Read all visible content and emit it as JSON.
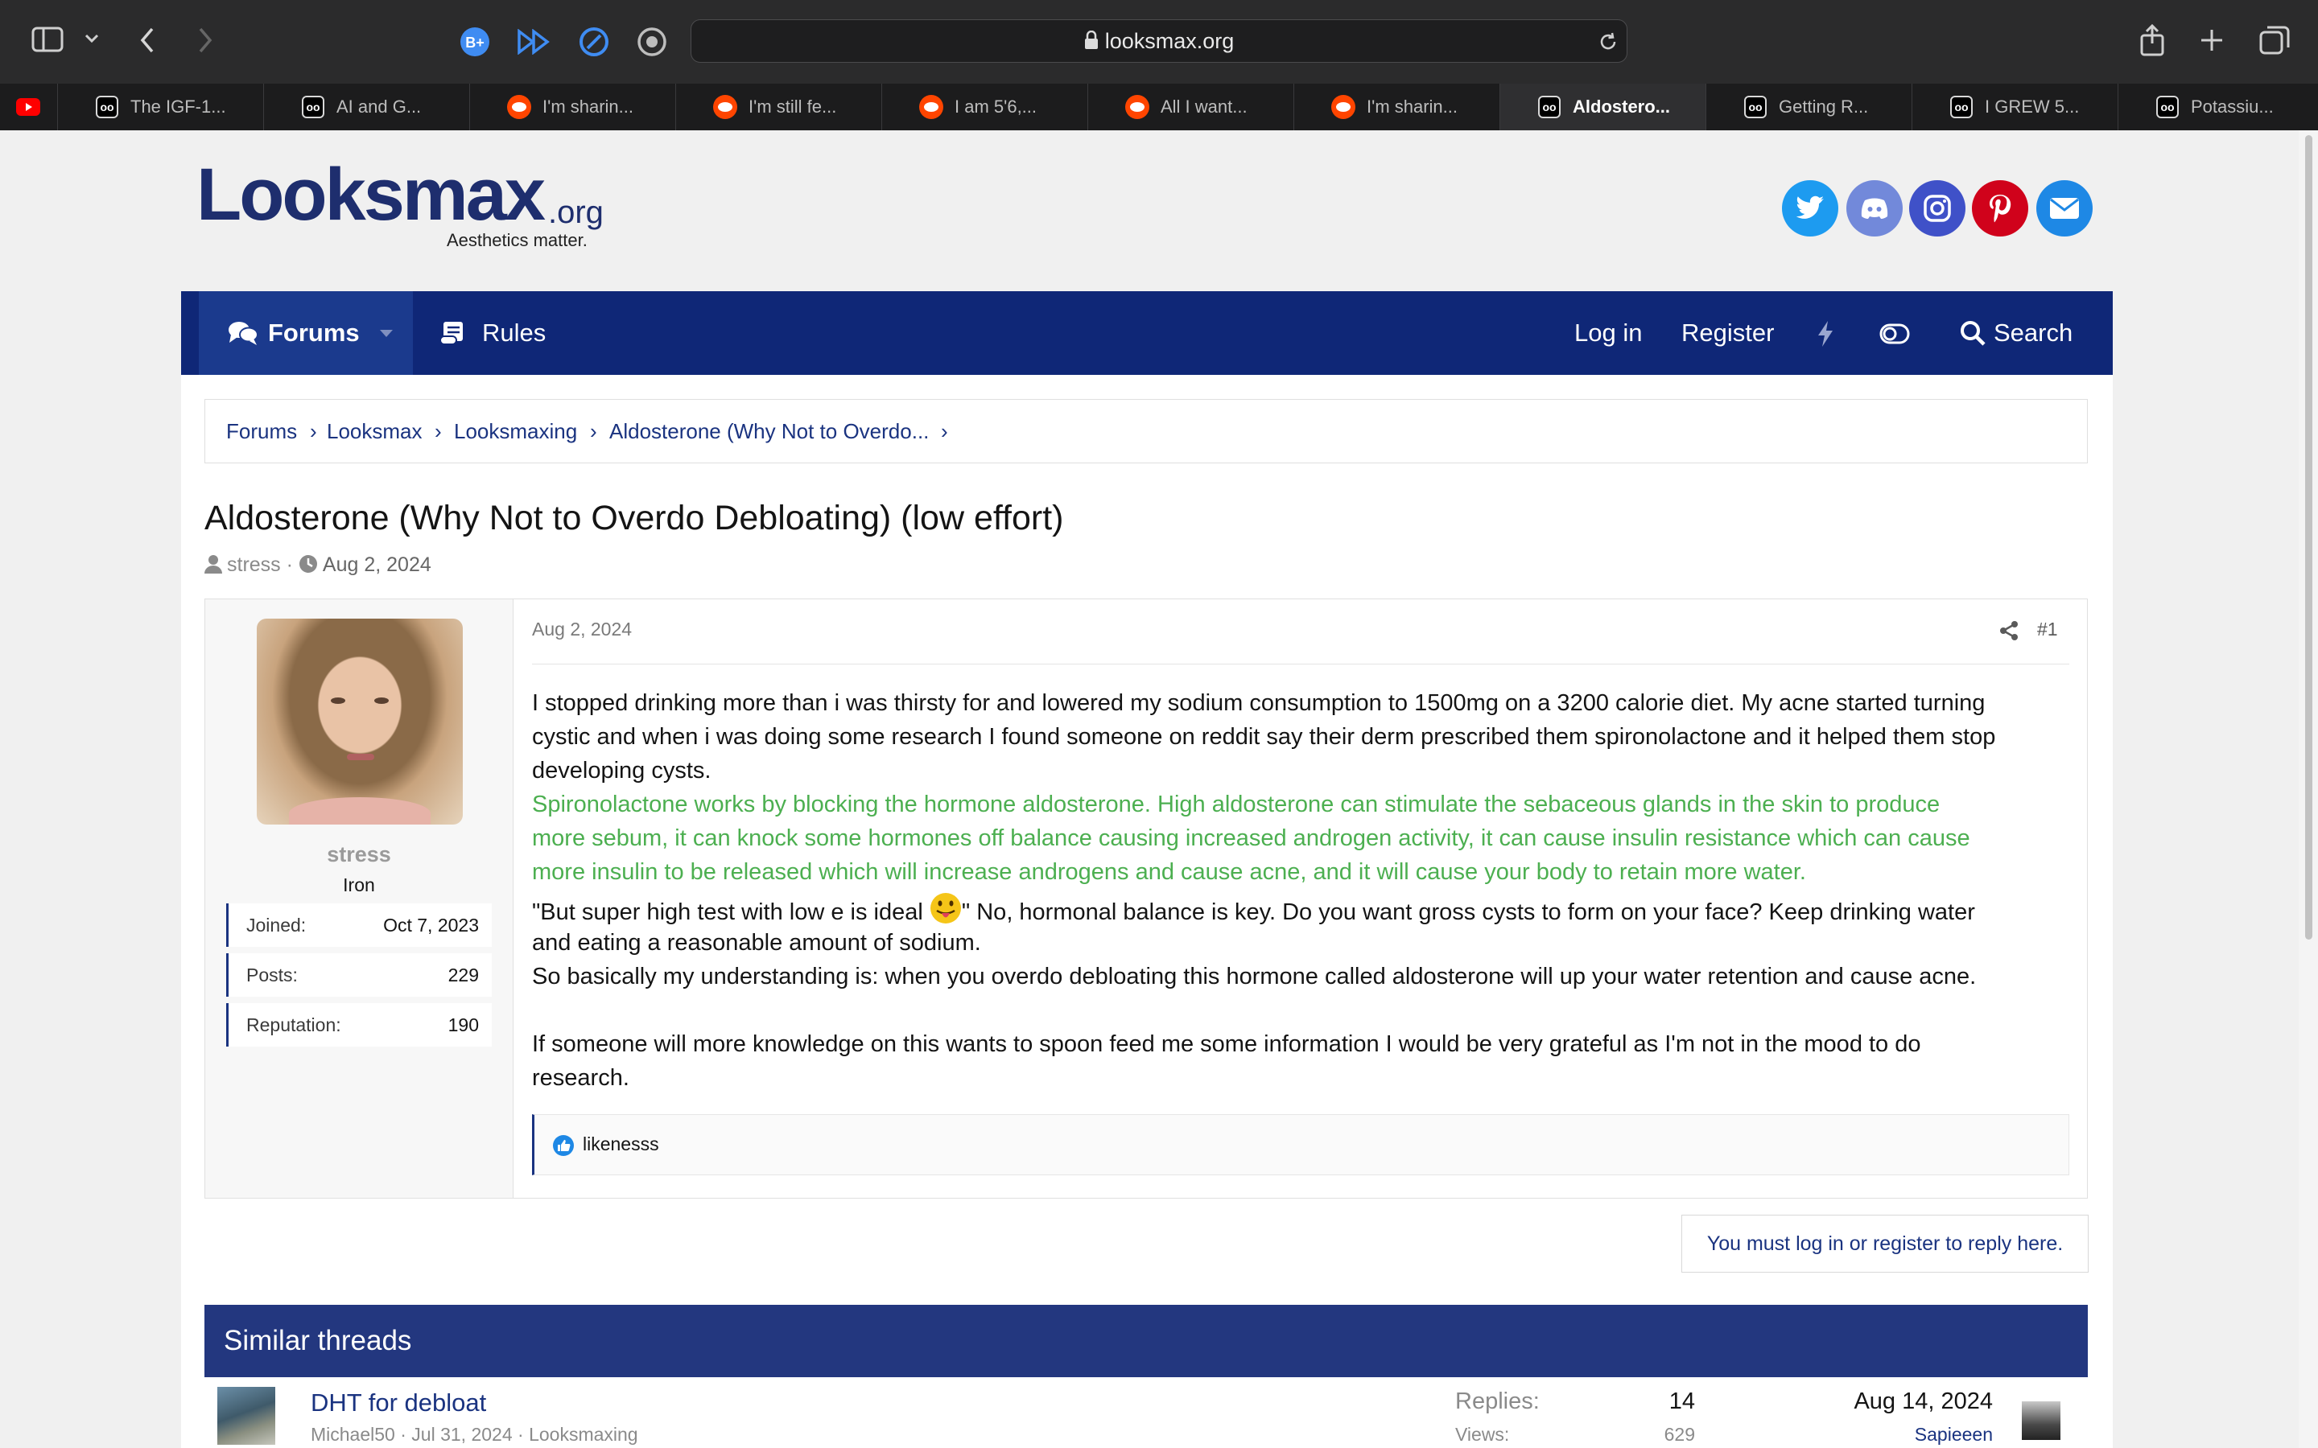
{
  "browser": {
    "url": "looksmax.org",
    "tabs": [
      {
        "label": "",
        "icon": "youtube-icon"
      },
      {
        "label": "The IGF-1...",
        "icon": "looksmax-icon"
      },
      {
        "label": "AI and G...",
        "icon": "looksmax-icon"
      },
      {
        "label": "I'm sharin...",
        "icon": "reddit-icon"
      },
      {
        "label": "I'm still fe...",
        "icon": "reddit-icon"
      },
      {
        "label": "I am 5'6,...",
        "icon": "reddit-icon"
      },
      {
        "label": "All I want...",
        "icon": "reddit-icon"
      },
      {
        "label": "I'm sharin...",
        "icon": "reddit-icon"
      },
      {
        "label": "Aldostero...",
        "icon": "looksmax-icon",
        "active": true
      },
      {
        "label": "Getting R...",
        "icon": "looksmax-icon"
      },
      {
        "label": "I GREW 5...",
        "icon": "looksmax-icon"
      },
      {
        "label": "Potassiu...",
        "icon": "looksmax-icon"
      }
    ]
  },
  "site": {
    "logo": "Looksmax",
    "logo_suffix": ".org",
    "tagline": "Aesthetics matter.",
    "social": [
      "twitter-icon",
      "discord-icon",
      "instagram-icon",
      "pinterest-icon",
      "email-icon"
    ]
  },
  "nav": {
    "forums": "Forums",
    "rules": "Rules",
    "login": "Log in",
    "register": "Register",
    "search": "Search"
  },
  "breadcrumbs": [
    "Forums",
    "Looksmax",
    "Looksmaxing",
    "Aldosterone (Why Not to Overdo..."
  ],
  "thread": {
    "title": "Aldosterone (Why Not to Overdo Debloating) (low effort)",
    "author": "stress",
    "date": "Aug 2, 2024"
  },
  "post": {
    "date": "Aug 2, 2024",
    "number": "#1",
    "user": {
      "name": "stress",
      "rank": "Iron",
      "stats": [
        {
          "label": "Joined:",
          "value": "Oct 7, 2023"
        },
        {
          "label": "Posts:",
          "value": "229"
        },
        {
          "label": "Reputation:",
          "value": "190"
        }
      ]
    },
    "lines": [
      "I stopped drinking more than i was thirsty for and lowered my sodium consumption to 1500mg on a 3200 calorie diet. My acne started turning",
      "cystic and when i was doing some research I found someone on reddit say their derm prescribed them spironolactone and it helped them stop",
      "developing cysts."
    ],
    "quote_lines": [
      "Spironolactone works by blocking the hormone aldosterone. High aldosterone can stimulate the sebaceous glands in the skin to produce",
      "more sebum, it can knock some hormones off balance causing increased androgen activity, it can cause insulin resistance which can cause",
      "more insulin to be released which will increase androgens and cause acne, and it will cause your body to retain more water."
    ],
    "line_ideal_a": "\"But super high test with low e is ideal ",
    "line_ideal_b": "\" No, hormonal balance is key. Do you want gross cysts to form on your face? Keep drinking water",
    "more_lines": [
      "and eating a reasonable amount of sodium.",
      "So basically my understanding is: when you overdo debloating this hormone called aldosterone will up your water retention and cause acne.",
      "",
      "If someone will more knowledge on this wants to spoon feed me some information I would be very grateful as I'm not in the mood to do",
      "research."
    ],
    "reaction_user": "likenesss"
  },
  "reply_notice": "You must log in or register to reply here.",
  "similar": {
    "heading": "Similar threads",
    "threads": [
      {
        "title": "DHT for debloat",
        "meta_author": "Michael50",
        "meta_date": "Jul 31, 2024",
        "meta_forum": "Looksmaxing",
        "replies_label": "Replies:",
        "replies": "14",
        "views_label": "Views:",
        "views": "629",
        "last_date": "Aug 14, 2024",
        "last_user": "Sapieeen"
      }
    ]
  }
}
